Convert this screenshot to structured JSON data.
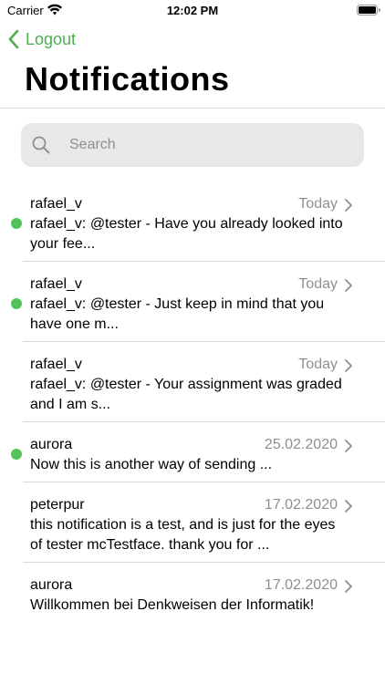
{
  "status_bar": {
    "carrier": "Carrier",
    "time": "12:02 PM"
  },
  "nav": {
    "back_label": "Logout",
    "title": "Notifications"
  },
  "search": {
    "placeholder": "Search",
    "value": ""
  },
  "colors": {
    "accent": "#4CAF50",
    "unread_dot": "#54C15A",
    "secondary_text": "#8e8e93",
    "search_bg": "#e8e8e8"
  },
  "notifications": [
    {
      "sender": "rafael_v",
      "date": "Today",
      "message": "rafael_v: @tester - Have you already looked into your fee...",
      "unread": true
    },
    {
      "sender": "rafael_v",
      "date": "Today",
      "message": "rafael_v: @tester - Just keep in mind that you have one m...",
      "unread": true
    },
    {
      "sender": "rafael_v",
      "date": "Today",
      "message": "rafael_v: @tester - Your assignment was graded and I am s...",
      "unread": false
    },
    {
      "sender": "aurora",
      "date": "25.02.2020",
      "message": "Now this is another way of sending ...",
      "unread": true
    },
    {
      "sender": "peterpur",
      "date": "17.02.2020",
      "message": "this notification is a test, and is just for the eyes of tester mcTestface. thank you for ...",
      "unread": false
    },
    {
      "sender": "aurora",
      "date": "17.02.2020",
      "message": "Willkommen bei Denkweisen der Informatik!",
      "unread": false
    }
  ]
}
